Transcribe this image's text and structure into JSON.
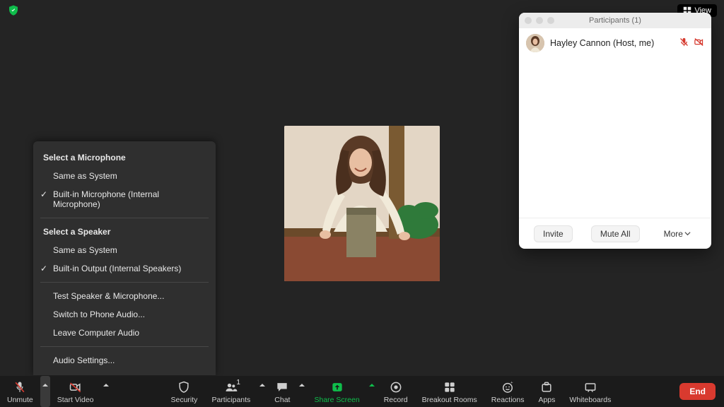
{
  "top": {
    "view_label": "View"
  },
  "participants_panel": {
    "title": "Participants (1)",
    "rows": [
      {
        "name": "Hayley Cannon (Host, me)",
        "mic_muted": true,
        "video_off": true
      }
    ],
    "footer": {
      "invite": "Invite",
      "mute_all": "Mute All",
      "more": "More"
    }
  },
  "audio_menu": {
    "mic_title": "Select a Microphone",
    "mic_items": [
      "Same as System",
      "Built-in Microphone (Internal Microphone)"
    ],
    "mic_checked_index": 1,
    "spk_title": "Select a Speaker",
    "spk_items": [
      "Same as System",
      "Built-in Output (Internal Speakers)"
    ],
    "spk_checked_index": 1,
    "extras": [
      "Test Speaker & Microphone...",
      "Switch to Phone Audio...",
      "Leave Computer Audio"
    ],
    "settings": "Audio Settings..."
  },
  "toolbar": {
    "unmute": "Unmute",
    "start_video": "Start Video",
    "security": "Security",
    "participants": "Participants",
    "participants_count": "1",
    "chat": "Chat",
    "share_screen": "Share Screen",
    "record": "Record",
    "breakout": "Breakout Rooms",
    "reactions": "Reactions",
    "apps": "Apps",
    "whiteboards": "Whiteboards",
    "end": "End"
  }
}
